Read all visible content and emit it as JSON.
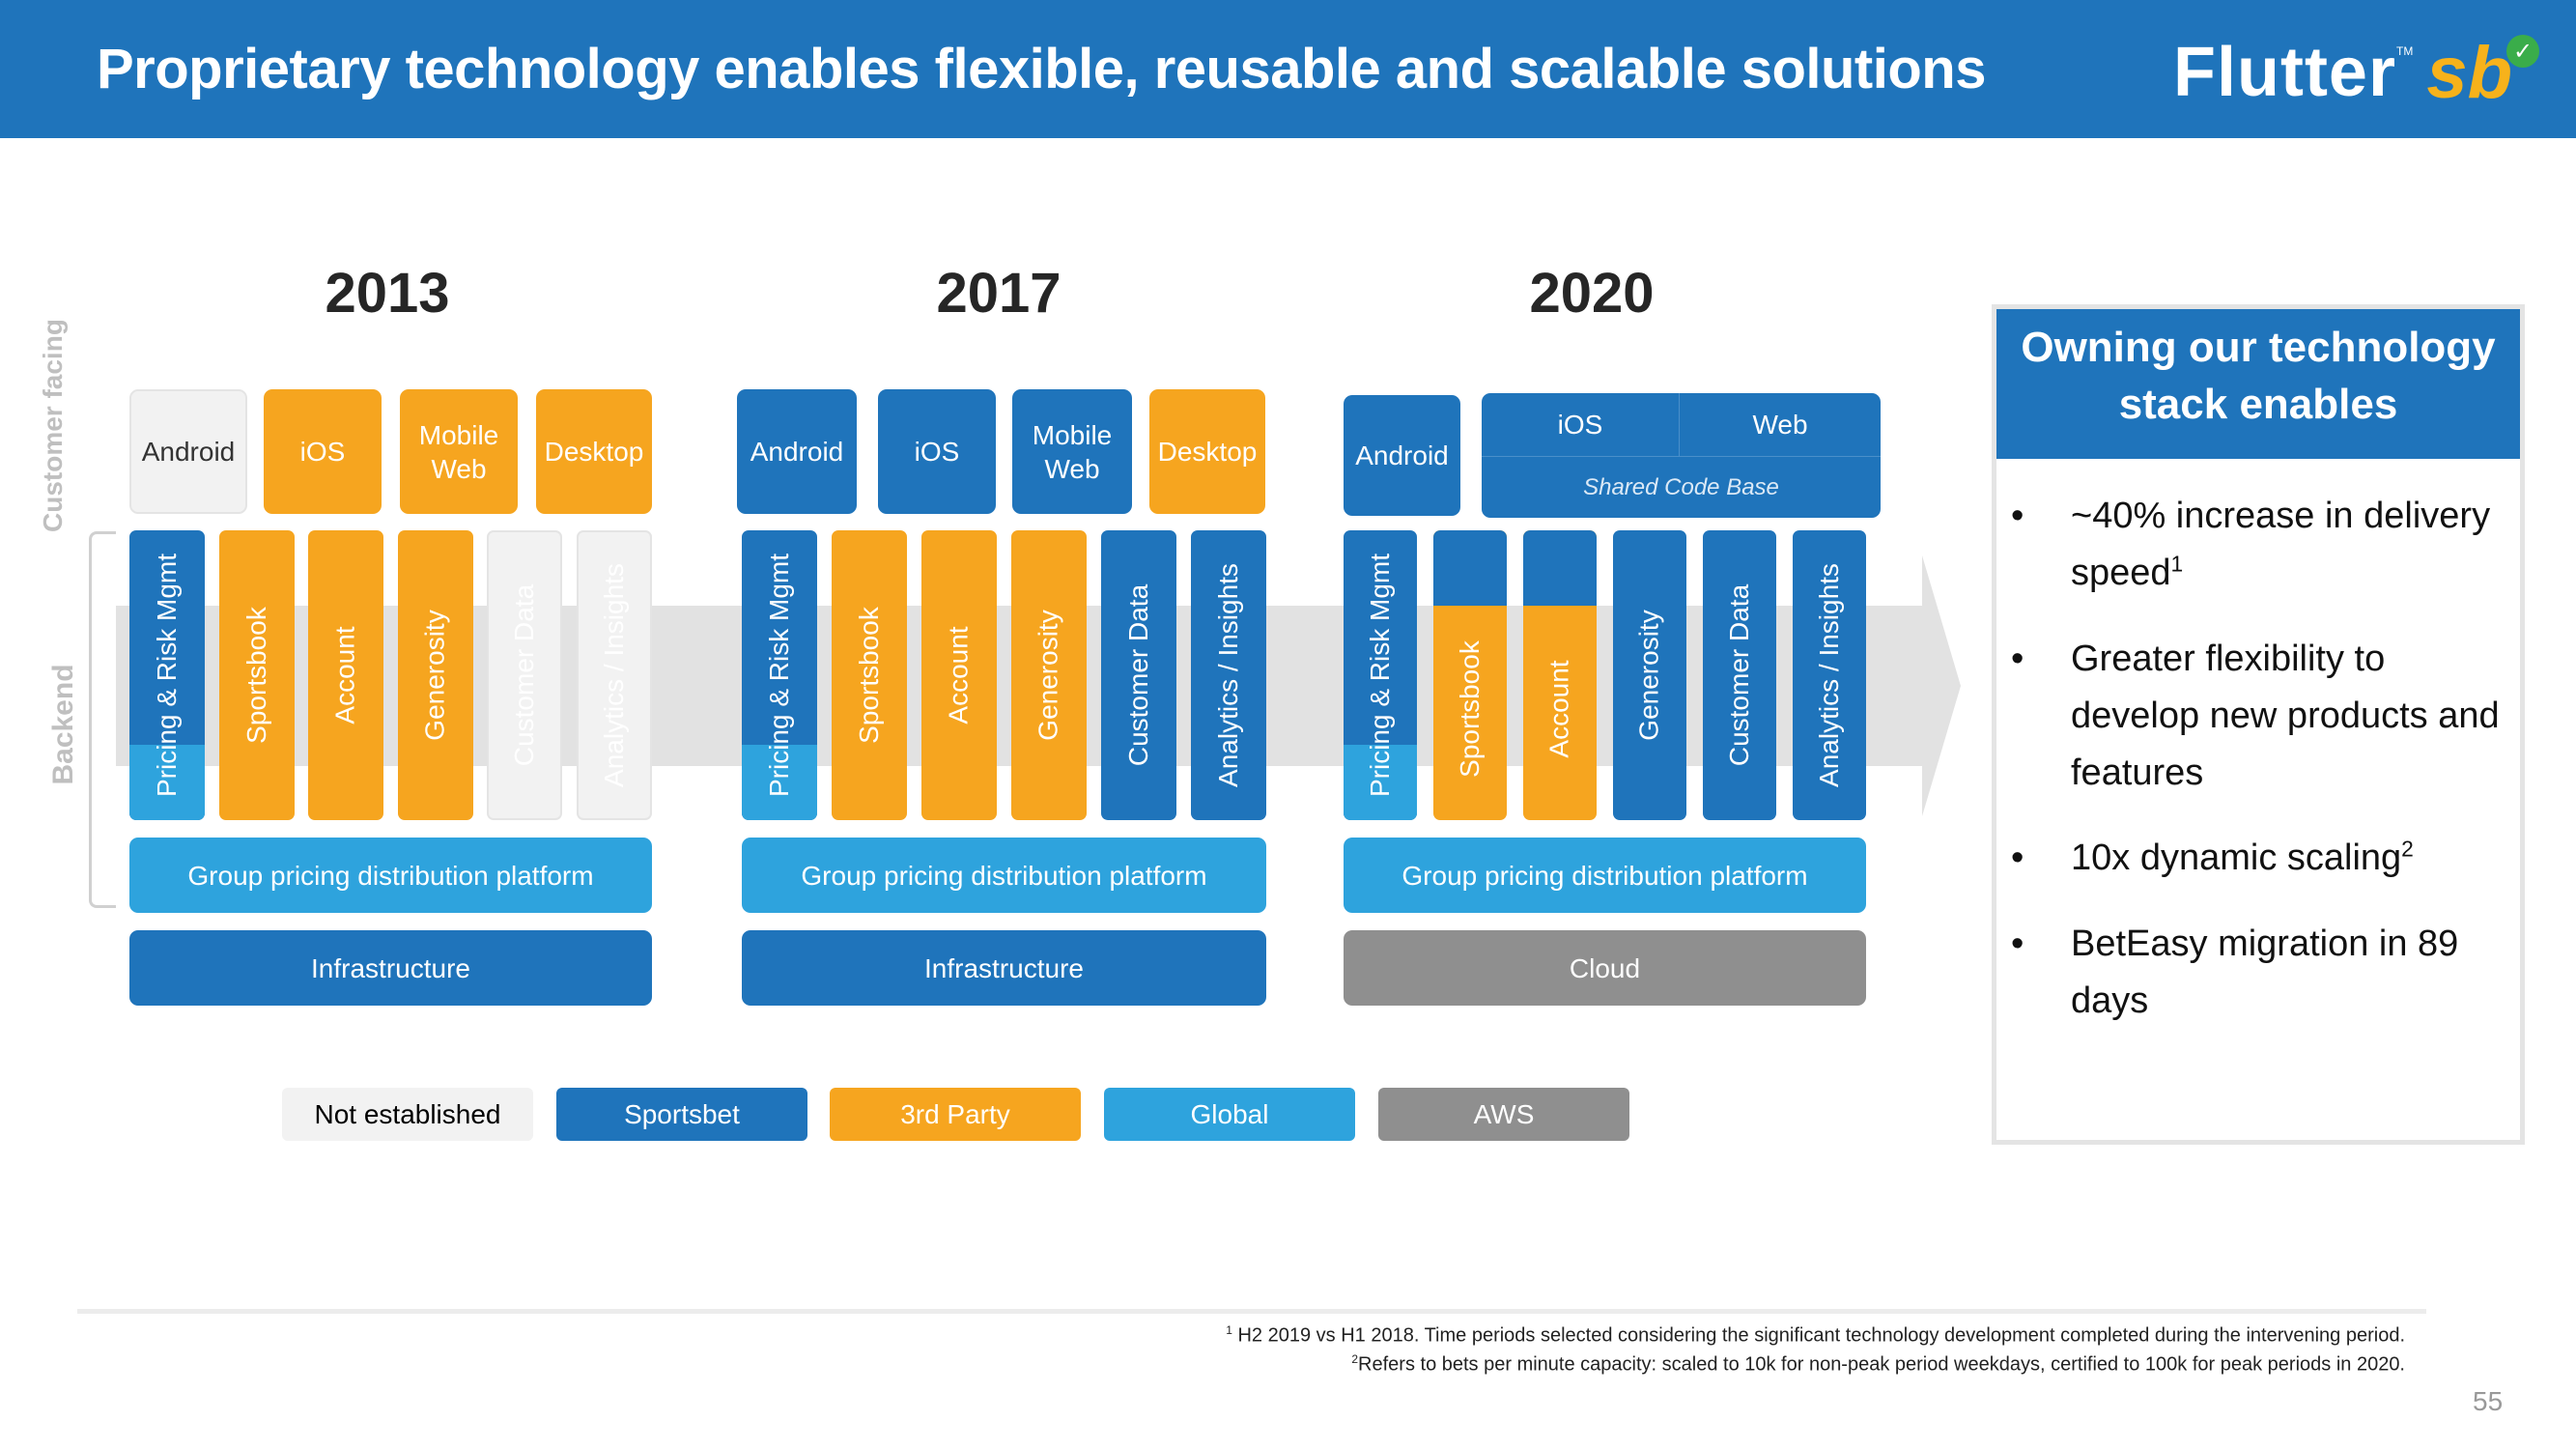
{
  "header": {
    "title": "Proprietary technology enables flexible, reusable and scalable solutions",
    "logo": {
      "brand": "Flutter",
      "trademark": "TM",
      "sub_brand": "sb",
      "check_icon": "check-icon"
    }
  },
  "side_labels": {
    "customer_facing": "Customer facing",
    "backend": "Backend"
  },
  "eras": [
    {
      "year": "2013",
      "customer": [
        {
          "label": "Android",
          "type": "not_established"
        },
        {
          "label": "iOS",
          "type": "third_party"
        },
        {
          "label": "Mobile Web",
          "type": "third_party"
        },
        {
          "label": "Desktop",
          "type": "third_party"
        }
      ],
      "backend": [
        {
          "label": "Pricing & Risk Mgmt",
          "type": "sportsbet",
          "bottom_type": "global"
        },
        {
          "label": "Sportsbook",
          "type": "third_party"
        },
        {
          "label": "Account",
          "type": "third_party"
        },
        {
          "label": "Generosity",
          "type": "third_party"
        },
        {
          "label": "Customer Data",
          "type": "not_established"
        },
        {
          "label": "Analytics / Insights",
          "type": "not_established"
        }
      ],
      "platform": {
        "label": "Group pricing distribution platform",
        "type": "global"
      },
      "base": {
        "label": "Infrastructure",
        "type": "sportsbet"
      }
    },
    {
      "year": "2017",
      "customer": [
        {
          "label": "Android",
          "type": "sportsbet"
        },
        {
          "label": "iOS",
          "type": "sportsbet"
        },
        {
          "label": "Mobile Web",
          "type": "sportsbet"
        },
        {
          "label": "Desktop",
          "type": "third_party"
        }
      ],
      "backend": [
        {
          "label": "Pricing & Risk Mgmt",
          "type": "sportsbet",
          "bottom_type": "global"
        },
        {
          "label": "Sportsbook",
          "type": "third_party"
        },
        {
          "label": "Account",
          "type": "third_party"
        },
        {
          "label": "Generosity",
          "type": "third_party"
        },
        {
          "label": "Customer Data",
          "type": "sportsbet"
        },
        {
          "label": "Analytics / Insights",
          "type": "sportsbet"
        }
      ],
      "platform": {
        "label": "Group pricing distribution platform",
        "type": "global"
      },
      "base": {
        "label": "Infrastructure",
        "type": "sportsbet"
      }
    },
    {
      "year": "2020",
      "customer": [
        {
          "label": "Android",
          "type": "sportsbet"
        }
      ],
      "shared_box": {
        "left": "iOS",
        "right": "Web",
        "caption": "Shared Code Base",
        "type": "sportsbet"
      },
      "backend": [
        {
          "label": "Pricing & Risk Mgmt",
          "type": "sportsbet",
          "bottom_type": "global"
        },
        {
          "label": "Sportsbook",
          "type": "third_party",
          "top_type": "sportsbet"
        },
        {
          "label": "Account",
          "type": "third_party",
          "top_type": "sportsbet"
        },
        {
          "label": "Generosity",
          "type": "sportsbet"
        },
        {
          "label": "Customer Data",
          "type": "sportsbet"
        },
        {
          "label": "Analytics / Insights",
          "type": "sportsbet"
        }
      ],
      "platform": {
        "label": "Group pricing distribution platform",
        "type": "global"
      },
      "base": {
        "label": "Cloud",
        "type": "aws"
      }
    }
  ],
  "legend": [
    {
      "label": "Not established",
      "type": "not_established"
    },
    {
      "label": "Sportsbet",
      "type": "sportsbet"
    },
    {
      "label": "3rd Party",
      "type": "third_party"
    },
    {
      "label": "Global",
      "type": "global"
    },
    {
      "label": "AWS",
      "type": "aws"
    }
  ],
  "colors": {
    "sportsbet": "#1f74bb",
    "third_party": "#f6a51f",
    "global": "#2ea3dd",
    "aws": "#8f8f8f",
    "not_established": "#f2f2f2",
    "header": "#1f74bb"
  },
  "panel": {
    "title": "Owning our technology stack enables",
    "bullets": [
      {
        "text": "~40% increase in delivery speed",
        "sup": "1"
      },
      {
        "text": "Greater flexibility to develop new products and features",
        "sup": ""
      },
      {
        "text": "10x dynamic scaling",
        "sup": "2"
      },
      {
        "text": "BetEasy migration in 89 days",
        "sup": ""
      }
    ]
  },
  "footnotes": [
    {
      "sup": "1",
      "text": " H2 2019 vs H1 2018. Time periods selected considering the significant technology development completed during the intervening period."
    },
    {
      "sup": "2",
      "text": "Refers to bets per minute capacity: scaled to 10k for non-peak period weekdays, certified to 100k for peak periods in 2020."
    }
  ],
  "page_number": "55"
}
